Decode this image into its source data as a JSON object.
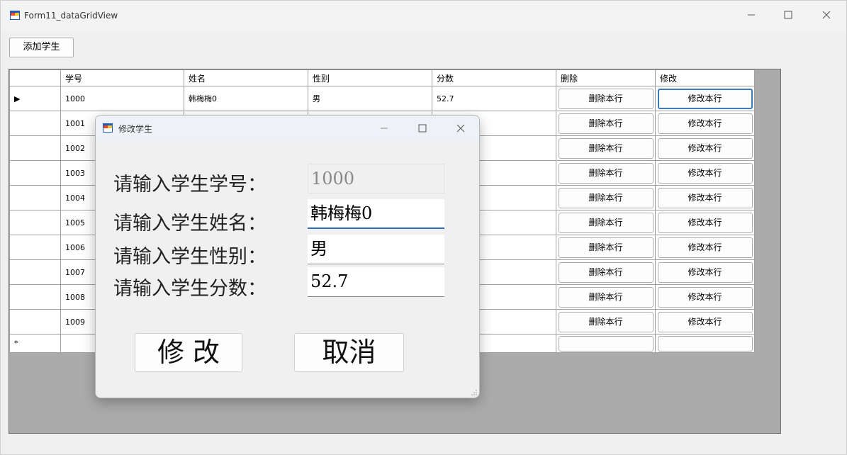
{
  "window": {
    "title": "Form11_dataGridView"
  },
  "toolbar": {
    "add_label": "添加学生"
  },
  "grid": {
    "columns": [
      "学号",
      "姓名",
      "性别",
      "分数",
      "删除",
      "修改"
    ],
    "rows": [
      {
        "id": "1000",
        "name": "韩梅梅0",
        "gender": "男",
        "score": "52.7",
        "delete": "删除本行",
        "edit": "修改本行"
      },
      {
        "id": "1001",
        "name": "",
        "gender": "",
        "score": "",
        "delete": "删除本行",
        "edit": "修改本行"
      },
      {
        "id": "1002",
        "name": "",
        "gender": "",
        "score": "",
        "delete": "删除本行",
        "edit": "修改本行"
      },
      {
        "id": "1003",
        "name": "",
        "gender": "",
        "score": "",
        "delete": "删除本行",
        "edit": "修改本行"
      },
      {
        "id": "1004",
        "name": "",
        "gender": "",
        "score": "",
        "delete": "删除本行",
        "edit": "修改本行"
      },
      {
        "id": "1005",
        "name": "",
        "gender": "",
        "score": "",
        "delete": "删除本行",
        "edit": "修改本行"
      },
      {
        "id": "1006",
        "name": "",
        "gender": "",
        "score": "",
        "delete": "删除本行",
        "edit": "修改本行"
      },
      {
        "id": "1007",
        "name": "",
        "gender": "",
        "score": "",
        "delete": "删除本行",
        "edit": "修改本行"
      },
      {
        "id": "1008",
        "name": "",
        "gender": "",
        "score": "",
        "delete": "删除本行",
        "edit": "修改本行"
      },
      {
        "id": "1009",
        "name": "",
        "gender": "",
        "score": "",
        "delete": "删除本行",
        "edit": "修改本行"
      }
    ],
    "current_row_marker": "▶",
    "new_row_marker": "*"
  },
  "dialog": {
    "title": "修改学生",
    "labels": {
      "id": "请输入学生学号：",
      "name": "请输入学生姓名：",
      "gender": "请输入学生性别：",
      "score": "请输入学生分数："
    },
    "values": {
      "id": "1000",
      "name": "韩梅梅0",
      "gender": "男",
      "score": "52.7"
    },
    "ok_label": "修 改",
    "cancel_label": "取消"
  },
  "colors": {
    "grid_bg": "#ababab",
    "window_bg": "#f0f0f0",
    "focus_border": "#3d7ab8"
  },
  "icons": {
    "app": "winforms-app-icon",
    "minimize": "minimize-icon",
    "maximize": "maximize-icon",
    "close": "close-icon"
  }
}
